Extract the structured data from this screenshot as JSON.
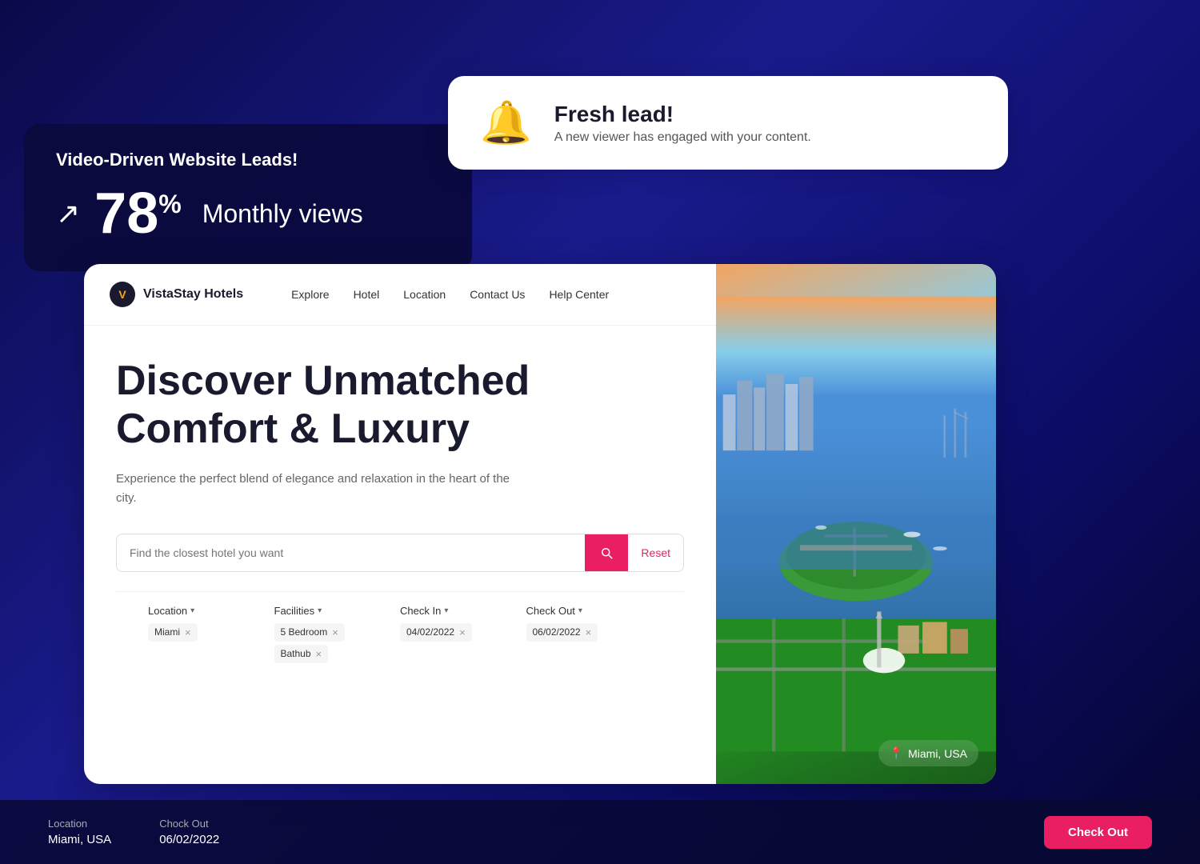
{
  "background": "#0a0a4a",
  "stats_card": {
    "title": "Video-Driven Website Leads!",
    "percent": "78",
    "percent_sign": "%",
    "label": "Monthly views",
    "arrow": "↗"
  },
  "notification": {
    "title": "Fresh lead!",
    "subtitle": "A new viewer has engaged with your content.",
    "bell": "🔔"
  },
  "hotel": {
    "brand": "VistaStay Hotels",
    "nav": {
      "links": [
        "Explore",
        "Hotel",
        "Location",
        "Contact Us",
        "Help Center"
      ]
    },
    "hero": {
      "title_line1": "Discover Unmatched",
      "title_line2": "Comfort & Luxury",
      "subtitle": "Experience the perfect blend of elegance and relaxation in the heart of the city."
    },
    "search": {
      "placeholder": "Find the closest hotel you want",
      "reset_label": "Reset"
    },
    "filters": {
      "location": {
        "label": "Location",
        "value": "Miami"
      },
      "facilities": {
        "label": "Facilities",
        "values": [
          "5 Bedroom",
          "Bathub"
        ]
      },
      "checkin": {
        "label": "Check In",
        "value": "04/02/2022"
      },
      "checkout": {
        "label": "Check Out",
        "value": "06/02/2022"
      }
    },
    "image_location": "Miami, USA"
  },
  "bottom_bar": {
    "location_label": "Location",
    "location_value": "Miami, USA",
    "checkout_label": "Chock Out",
    "checkout_value": "06/02/2022",
    "checkout_btn": "Check Out"
  }
}
